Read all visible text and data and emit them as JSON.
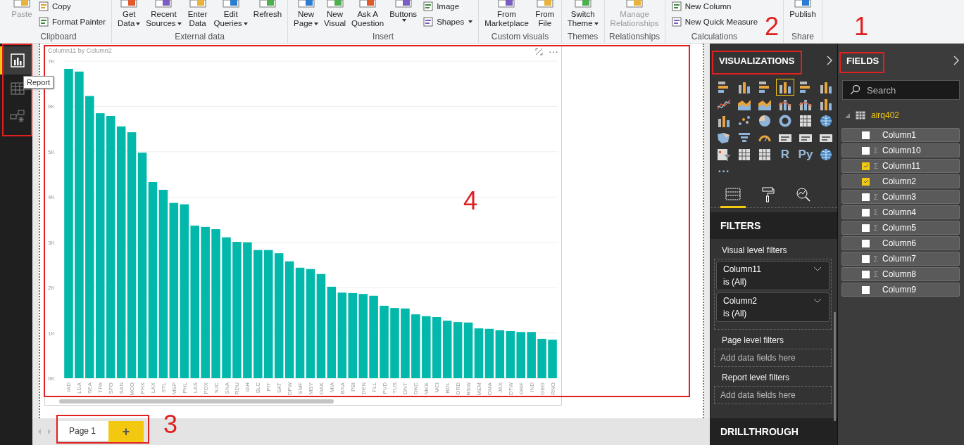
{
  "ribbon": {
    "groups": [
      {
        "label": "Clipboard",
        "buttons": [
          {
            "kind": "large",
            "lines": [
              "Paste"
            ],
            "dropdown": false,
            "disabled": true
          },
          {
            "kind": "small",
            "lines": [
              "Copy"
            ],
            "dropdown": false,
            "disabled": false
          },
          {
            "kind": "small",
            "lines": [
              "Format Painter"
            ],
            "dropdown": false,
            "disabled": false
          }
        ]
      },
      {
        "label": "External data",
        "buttons": [
          {
            "kind": "large",
            "lines": [
              "Get",
              "Data"
            ],
            "dropdown": true,
            "disabled": false
          },
          {
            "kind": "large",
            "lines": [
              "Recent",
              "Sources"
            ],
            "dropdown": true,
            "disabled": false
          },
          {
            "kind": "large",
            "lines": [
              "Enter",
              "Data"
            ],
            "dropdown": false,
            "disabled": false
          },
          {
            "kind": "large",
            "lines": [
              "Edit",
              "Queries"
            ],
            "dropdown": true,
            "disabled": false
          },
          {
            "kind": "large",
            "lines": [
              "Refresh"
            ],
            "dropdown": false,
            "disabled": false
          }
        ]
      },
      {
        "label": "Insert",
        "buttons": [
          {
            "kind": "large",
            "lines": [
              "New",
              "Page"
            ],
            "dropdown": true,
            "disabled": false
          },
          {
            "kind": "large",
            "lines": [
              "New",
              "Visual"
            ],
            "dropdown": false,
            "disabled": false
          },
          {
            "kind": "large",
            "lines": [
              "Ask A",
              "Question"
            ],
            "dropdown": false,
            "disabled": false
          },
          {
            "kind": "large",
            "lines": [
              "Buttons"
            ],
            "dropdown": true,
            "disabled": false
          },
          {
            "kind": "small",
            "lines": [
              "Image"
            ],
            "dropdown": false,
            "disabled": false
          },
          {
            "kind": "small",
            "lines": [
              "Shapes"
            ],
            "dropdown": true,
            "disabled": false
          }
        ]
      },
      {
        "label": "Custom visuals",
        "buttons": [
          {
            "kind": "large",
            "lines": [
              "From",
              "Marketplace"
            ],
            "dropdown": false,
            "disabled": false
          },
          {
            "kind": "large",
            "lines": [
              "From",
              "File"
            ],
            "dropdown": false,
            "disabled": false
          }
        ]
      },
      {
        "label": "Themes",
        "buttons": [
          {
            "kind": "large",
            "lines": [
              "Switch",
              "Theme"
            ],
            "dropdown": true,
            "disabled": false
          }
        ]
      },
      {
        "label": "Relationships",
        "buttons": [
          {
            "kind": "large",
            "lines": [
              "Manage",
              "Relationships"
            ],
            "dropdown": false,
            "disabled": true
          }
        ]
      },
      {
        "label": "Calculations",
        "buttons": [
          {
            "kind": "small",
            "lines": [
              "New Column"
            ],
            "dropdown": false,
            "disabled": false
          },
          {
            "kind": "small",
            "lines": [
              "New Quick Measure"
            ],
            "dropdown": false,
            "disabled": false
          }
        ]
      },
      {
        "label": "Share",
        "buttons": [
          {
            "kind": "large",
            "lines": [
              "Publish"
            ],
            "dropdown": false,
            "disabled": false
          }
        ]
      }
    ]
  },
  "nav": {
    "items": [
      {
        "kind": "report",
        "selected": true
      },
      {
        "kind": "data",
        "selected": false
      },
      {
        "kind": "model",
        "selected": false
      }
    ],
    "tooltip": "Report"
  },
  "visual": {
    "more": "···",
    "chart_data": {
      "type": "bar",
      "title": "Column11 by Column2",
      "grid": true,
      "categories": [
        "IAD",
        "LGA",
        "SEA",
        "TPA",
        "SFO",
        "SAN",
        "MCO",
        "PHX",
        "LAX",
        "STL",
        "MSP",
        "PHL",
        "LAS",
        "PDX",
        "SJC",
        "SNA",
        "RDU",
        "IAH",
        "SLC",
        "PIT",
        "SAT",
        "DFW",
        "SMF",
        "MSY",
        "OAK",
        "MIA",
        "BNA",
        "PBI",
        "DEN",
        "FLL",
        "PVD",
        "TUS",
        "ONT",
        "OKC",
        "MKE",
        "MCI",
        "BDL",
        "ORD",
        "RSW",
        "MEM",
        "OMA",
        "JAX",
        "DTW",
        "ORF",
        "IND",
        "GEG",
        "RNO"
      ],
      "values": [
        6830,
        6770,
        6230,
        5850,
        5790,
        5560,
        5430,
        4980,
        4330,
        4160,
        3870,
        3840,
        3370,
        3340,
        3290,
        3110,
        3010,
        3000,
        2830,
        2830,
        2760,
        2580,
        2440,
        2410,
        2300,
        2020,
        1890,
        1880,
        1860,
        1820,
        1600,
        1550,
        1540,
        1410,
        1370,
        1350,
        1270,
        1240,
        1230,
        1100,
        1090,
        1060,
        1040,
        1020,
        1020,
        870,
        850
      ],
      "ylim": [
        0,
        7000
      ],
      "yticks": [
        {
          "value": 0,
          "label": "0K"
        },
        {
          "value": 1000,
          "label": "1K"
        },
        {
          "value": 2000,
          "label": "2K"
        },
        {
          "value": 3000,
          "label": "3K"
        },
        {
          "value": 4000,
          "label": "4K"
        },
        {
          "value": 5000,
          "label": "5K"
        },
        {
          "value": 6000,
          "label": "6K"
        },
        {
          "value": 7000,
          "label": "7K"
        }
      ]
    }
  },
  "pages": {
    "tabs": [
      {
        "label": "Page 1",
        "selected": true
      }
    ],
    "add": "+"
  },
  "visualizations": {
    "title": "VISUALIZATIONS",
    "visuals": [
      {
        "kind": "hbar",
        "selected": false
      },
      {
        "kind": "vbar",
        "selected": false
      },
      {
        "kind": "hbar",
        "selected": false
      },
      {
        "kind": "vbar",
        "selected": true
      },
      {
        "kind": "hbar",
        "selected": false
      },
      {
        "kind": "vbar",
        "selected": false
      },
      {
        "kind": "line",
        "selected": false
      },
      {
        "kind": "area",
        "selected": false
      },
      {
        "kind": "area",
        "selected": false
      },
      {
        "kind": "combo",
        "selected": false
      },
      {
        "kind": "combo",
        "selected": false
      },
      {
        "kind": "vbar",
        "selected": false
      },
      {
        "kind": "vbar",
        "selected": false
      },
      {
        "kind": "scatter",
        "selected": false
      },
      {
        "kind": "pie",
        "selected": false
      },
      {
        "kind": "donut",
        "selected": false
      },
      {
        "kind": "grid",
        "selected": false
      },
      {
        "kind": "globe",
        "selected": false
      },
      {
        "kind": "map",
        "selected": false
      },
      {
        "kind": "funnel",
        "selected": false
      },
      {
        "kind": "gauge",
        "selected": false
      },
      {
        "kind": "card",
        "selected": false
      },
      {
        "kind": "card",
        "selected": false
      },
      {
        "kind": "card",
        "selected": false
      },
      {
        "kind": "slicer",
        "selected": false
      },
      {
        "kind": "grid",
        "selected": false
      },
      {
        "kind": "grid",
        "selected": false
      },
      {
        "kind": "letter",
        "label": "R",
        "selected": false
      },
      {
        "kind": "letter",
        "label": "Py",
        "selected": false
      },
      {
        "kind": "globe",
        "selected": false
      },
      {
        "kind": "letter",
        "label": "···",
        "selected": false
      }
    ],
    "tabs": [
      {
        "kind": "fields",
        "selected": true
      },
      {
        "kind": "format",
        "selected": false
      },
      {
        "kind": "analytics",
        "selected": false
      }
    ],
    "filters": {
      "title": "FILTERS",
      "sections": [
        {
          "label": "Visual level filters",
          "cards": [
            {
              "field": "Column11",
              "condition": "is (All)"
            },
            {
              "field": "Column2",
              "condition": "is (All)"
            }
          ]
        },
        {
          "label": "Page level filters",
          "dropzone": "Add data fields here"
        },
        {
          "label": "Report level filters",
          "dropzone": "Add data fields here"
        }
      ]
    },
    "drillthrough": "DRILLTHROUGH"
  },
  "fields": {
    "title": "FIELDS",
    "search": {
      "placeholder": "Search"
    },
    "tables": [
      {
        "name": "airq402",
        "expanded": true,
        "children": [
          {
            "name": "Column1",
            "checked": false
          },
          {
            "name": "Column10",
            "checked": false,
            "sigma": "Σ"
          },
          {
            "name": "Column11",
            "checked": true,
            "sigma": "Σ"
          },
          {
            "name": "Column2",
            "checked": true
          },
          {
            "name": "Column3",
            "checked": false,
            "sigma": "Σ"
          },
          {
            "name": "Column4",
            "checked": false,
            "sigma": "Σ"
          },
          {
            "name": "Column5",
            "checked": false,
            "sigma": "Σ"
          },
          {
            "name": "Column6",
            "checked": false
          },
          {
            "name": "Column7",
            "checked": false,
            "sigma": "Σ"
          },
          {
            "name": "Column8",
            "checked": false,
            "sigma": "Σ"
          },
          {
            "name": "Column9",
            "checked": false
          }
        ]
      }
    ]
  },
  "annotations": [
    "1",
    "2",
    "3",
    "4"
  ]
}
